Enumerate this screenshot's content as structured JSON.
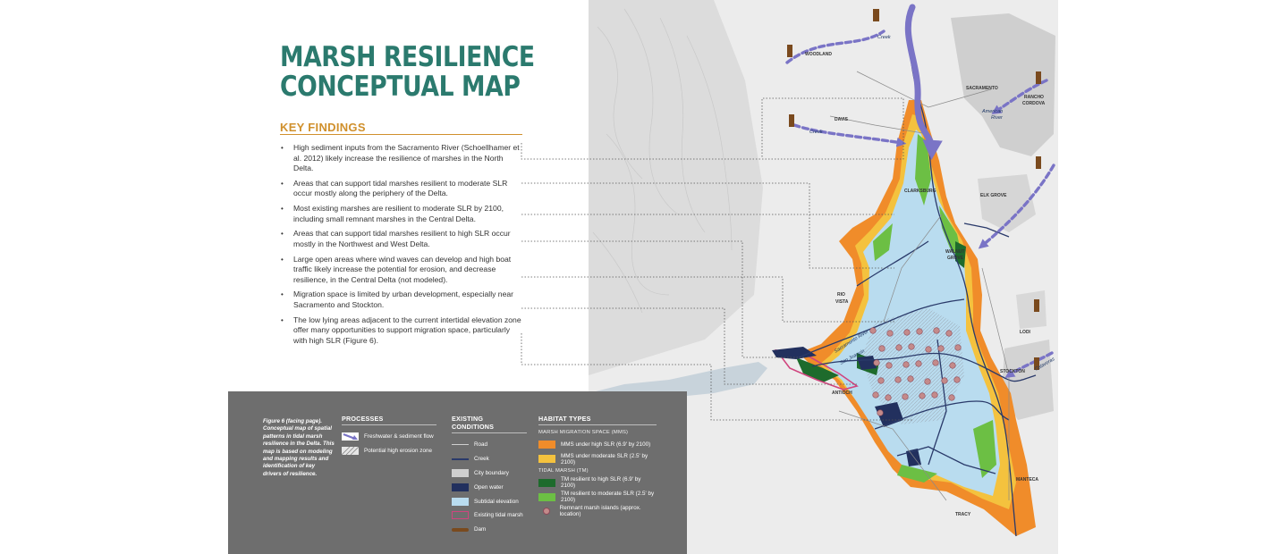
{
  "header": {
    "title_line1": "MARSH RESILIENCE",
    "title_line2": "CONCEPTUAL MAP",
    "section_heading": "KEY FINDINGS"
  },
  "findings": [
    "High sediment inputs from the Sacramento River (Schoellhamer et al. 2012) likely increase the resilience of marshes in the North Delta.",
    "Areas that can support tidal marshes resilient to moderate SLR occur mostly along the periphery of the Delta.",
    "Most existing marshes are resilient to moderate SLR by 2100, including small remnant marshes in the Central Delta.",
    "Areas that can support tidal marshes resilient to high SLR occur mostly in the Northwest and West Delta.",
    "Large open areas where wind waves can develop and high boat traffic likely increase the potential for erosion, and decrease resilience, in the Central Delta (not modeled).",
    "Migration space is limited by urban development, especially near Sacramento and Stockton.",
    "The low lying areas adjacent to the current intertidal elevation zone offer many opportunities to support migration space, particularly with high SLR (Figure 6)."
  ],
  "map": {
    "places": {
      "woodland": "WOODLAND",
      "sacramento": "SACRAMENTO",
      "rancho": "RANCHO",
      "cordova": "CORDOVA",
      "davis": "DAVIS",
      "clarksburg": "CLARKSBURG",
      "elk_grove": "ELK GROVE",
      "walnut": "WALNUT",
      "grove": "GROVE",
      "rio": "RIO",
      "vista": "VISTA",
      "lodi": "LODI",
      "stockton": "STOCKTON",
      "antioch": "ANTIOCH",
      "manteca": "MANTECA",
      "tracy": "TRACY"
    },
    "rivers": {
      "cache_creek": "Creek",
      "american_river": "American",
      "river_word": "River",
      "putah_creek": "Creek",
      "sacramento_river": "Sacramento River",
      "san_joaquin": "San Joaquin",
      "calaveras": "Calaveras"
    },
    "marsh_island_count": 31
  },
  "legend": {
    "caption": "Figure 6 (facing page). Conceptual map of spatial patterns in tidal marsh resilience in the Delta. This map is based on modeling and mapping results and identification of key drivers of resilience.",
    "processes": {
      "title": "PROCESSES",
      "items": [
        {
          "label": "Freshwater & sediment flow"
        },
        {
          "label": "Potential high erosion zone"
        }
      ]
    },
    "existing": {
      "title": "EXISTING CONDITIONS",
      "items": [
        {
          "label": "Road",
          "color": "#9a9a9a"
        },
        {
          "label": "Creek",
          "color": "#2a3a6a"
        },
        {
          "label": "City boundary",
          "color": "#cfcfcf"
        },
        {
          "label": "Open water",
          "color": "#22305e"
        },
        {
          "label": "Subtidal elevation",
          "color": "#b9dcef"
        },
        {
          "label": "Existing tidal marsh",
          "color": "#d0457e"
        },
        {
          "label": "Dam",
          "color": "#7a4a1e"
        }
      ]
    },
    "habitat": {
      "title": "HABITAT TYPES",
      "mms_title": "MARSH MIGRATION SPACE (MMS)",
      "mms": [
        {
          "label": "MMS under high SLR (6.9' by 2100)",
          "color": "#f08c2a"
        },
        {
          "label": "MMS under moderate SLR (2.5' by 2100)",
          "color": "#f4c23e"
        }
      ],
      "tm_title": "TIDAL MARSH (TM)",
      "tm": [
        {
          "label": "TM resilient to high SLR (6.9' by 2100)",
          "color": "#1e6b2c"
        },
        {
          "label": "TM resilient to moderate SLR (2.5' by 2100)",
          "color": "#6cbf44"
        }
      ],
      "remnant": {
        "label": "Remnant marsh islands (approx. location)",
        "color": "#c48a8a"
      }
    }
  }
}
